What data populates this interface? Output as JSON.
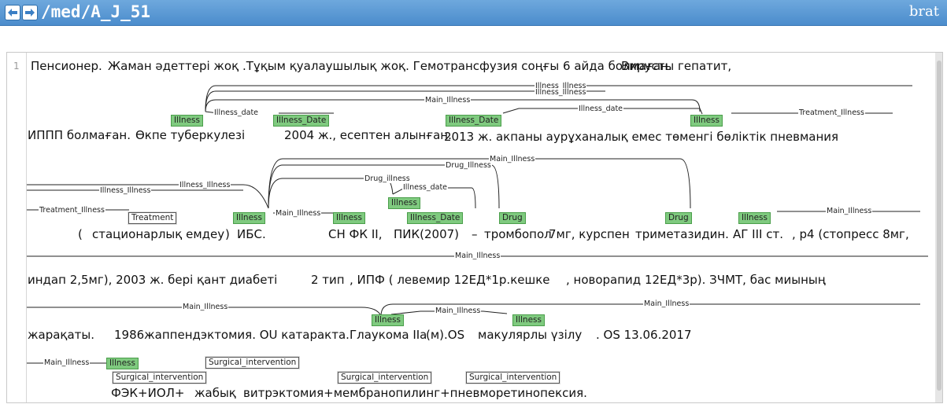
{
  "header": {
    "document_path": "/med/A_J_51",
    "brand": "brat",
    "back_icon": "back-arrow-icon",
    "forward_icon": "forward-arrow-icon"
  },
  "editor": {
    "line_number": "1"
  },
  "colors": {
    "entity": "#7fca7f",
    "entity_border": "#4a9e4a",
    "treatment": "#ffffff",
    "header": "#5a98d4"
  },
  "text_rows": [
    [
      "Пенсионер.",
      "Жаман әдеттері жоқ .Тұқым қуалаушылық жоқ. Гемотрансфузия соңғы 6 айда болмаған.",
      "Вирусты гепатит,"
    ],
    [
      "ИППП болмаған.",
      "Өкпе туберкулезі",
      "2004 ж., есептен алынған.",
      "2013 ж. акпаны аурұханалық емес төменгі бөліктік пневмания"
    ],
    [
      "(",
      "стационарлық емдеу",
      ")",
      "ИБС.",
      "СН ФК II,",
      "ПИК(2007)",
      "–",
      "тромбопол",
      "7мг, курспен",
      "триметазидин.",
      "АГ III ст.",
      ", р4 (стопресс 8мг,"
    ],
    [
      "индап 2,5мг), 2003 ж. бері қант диабеті",
      "2 тип",
      ", ИПФ ( левемир 12ЕД*1р.кешке",
      ", новорапид 12ЕД*3р). ЗЧМТ, бас миының"
    ],
    [
      "жарақаты.",
      "1986жаппендэктомия. OU катаракта.",
      "Глаукома IIa",
      "(м).OS",
      "макулярлы үзілу",
      ". OS 13.06.2017"
    ],
    [
      "ФЭК+ИОЛ+",
      "жабық",
      "витрэктомия+мембранопилинг+пневморетинопексия."
    ]
  ],
  "entity_tags": [
    "Illness",
    "Illness_Date",
    "Illness_Date",
    "Illness",
    "Treatment",
    "Illness",
    "Illness",
    "Illness_Date",
    "Illness",
    "Drug",
    "Drug",
    "Illness",
    "Illness",
    "Illness",
    "Illness",
    "Surgical_intervention",
    "Surgical_intervention",
    "Surgical_intervention",
    "Surgical_intervention"
  ],
  "relation_labels": [
    "Illness_Illness",
    "Illness_Illness",
    "Main_Illness",
    "Illness_date",
    "Illness_date",
    "Treatment_Illness",
    "Main_Illness",
    "Drug_Illness",
    "Drug_illness",
    "Illness_Illness",
    "Illness_Illness",
    "Illness_date",
    "Treatment_Illness",
    "Main_Illness",
    "Main_Illness",
    "Main_Illness",
    "Main_Illness",
    "Main_Illness",
    "Main_Illness",
    "Main_Illness"
  ]
}
